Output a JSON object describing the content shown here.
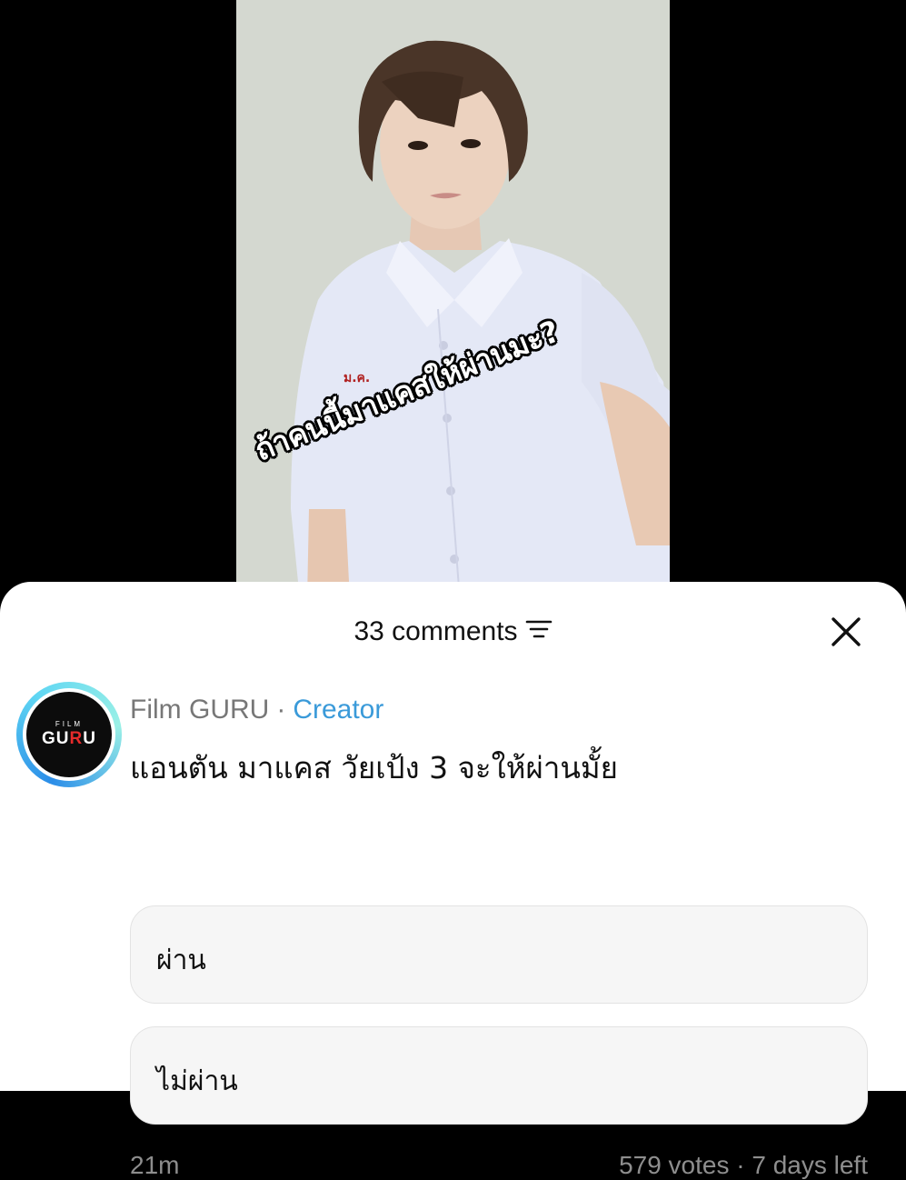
{
  "video": {
    "caption": "ถ้าคนนี้มาแคสให้ผ่านมะ?",
    "shirt_badge": "ม.ค."
  },
  "comments_header": {
    "title": "33 comments",
    "sort_icon": "sort-lines-icon",
    "close_icon": "close-x-icon"
  },
  "comment": {
    "avatar": {
      "logo_top": "FILM",
      "logo_left": "GU",
      "logo_red": "R",
      "logo_right": "U"
    },
    "author": "Film GURU",
    "separator": "·",
    "badge": "Creator",
    "question": "แอนตัน มาแคส วัยเป้ง 3 จะให้ผ่านมั้ย",
    "poll_options": [
      "ผ่าน",
      "ไม่ผ่าน"
    ],
    "time": "21m",
    "votes_summary": "579 votes · 7 days left"
  },
  "colors": {
    "creator_blue": "#3a9ad9",
    "meta_gray": "#8e8e8e",
    "option_bg": "#f6f6f6"
  }
}
